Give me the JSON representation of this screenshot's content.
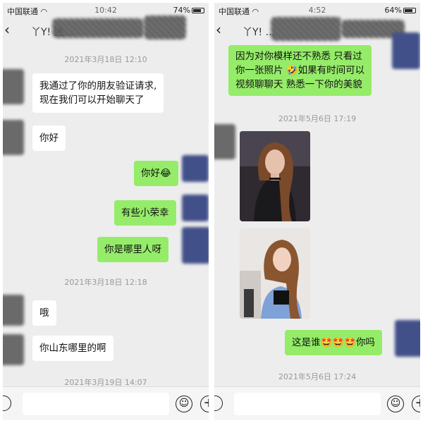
{
  "left": {
    "status": {
      "carrier": "中国联通",
      "wifi": "wifi-icon",
      "time": "10:42",
      "battery": "74%"
    },
    "nav": {
      "back": "‹",
      "title": "丫Y! 迷..."
    },
    "timestamps": [
      "2021年3月18日 12:10",
      "2021年3月18日 12:18",
      "2021年3月19日 14:07"
    ],
    "messages": [
      {
        "from": "them",
        "lines": [
          "我通过了你的朋友验证请求,",
          "现在我们可以开始聊天了"
        ]
      },
      {
        "from": "them",
        "text": "你好"
      },
      {
        "from": "me",
        "text": "你好",
        "emoji": "laughing-face"
      },
      {
        "from": "me",
        "text": "有些小荣幸"
      },
      {
        "from": "me",
        "text": "你是哪里人呀"
      },
      {
        "from": "them",
        "text": "哦"
      },
      {
        "from": "them",
        "text": "你山东哪里的啊"
      }
    ]
  },
  "right": {
    "status": {
      "carrier": "中国联通",
      "wifi": "wifi-icon",
      "time": "4:52",
      "battery": "64%"
    },
    "nav": {
      "back": "‹",
      "title": "丫Y! ..."
    },
    "timestamps": [
      "2021年5月6日 17:19",
      "2021年5月6日 17:24"
    ],
    "messages": [
      {
        "from": "me",
        "lines": [
          "因为对你模样还不熟悉 只看过",
          "你一张照片 ",
          "如果有时间可以",
          "视频聊聊天 熟悉一下你的美貌"
        ],
        "emoji": "grinning-face"
      },
      {
        "from": "them",
        "type": "photo",
        "subject": "woman-portrait-dark"
      },
      {
        "from": "them",
        "type": "photo",
        "subject": "woman-portrait-light"
      },
      {
        "from": "me",
        "text_a": "这是谁",
        "text_b": "你吗",
        "emoji": "star-struck-face"
      }
    ]
  },
  "input": {
    "voice_icon": "voice-icon",
    "emoji_icon": "emoji-icon",
    "plus_icon": "plus-icon"
  },
  "colors": {
    "bg": "#ededed",
    "out_bubble": "#95ec69",
    "in_bubble": "#ffffff",
    "timestamp": "#999999"
  }
}
